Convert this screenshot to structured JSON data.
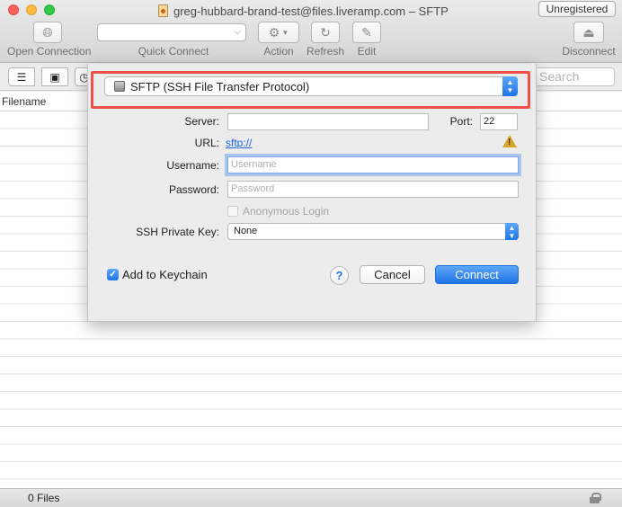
{
  "window": {
    "title": "greg-hubbard-brand-test@files.liveramp.com – SFTP",
    "badge": "Unregistered"
  },
  "toolbar": {
    "open_connection": "Open Connection",
    "quick_connect": "Quick Connect",
    "quick_connect_value": "",
    "action": "Action",
    "refresh": "Refresh",
    "edit": "Edit",
    "disconnect": "Disconnect"
  },
  "browser": {
    "search_placeholder": "Search",
    "column_filename": "Filename",
    "status": "0 Files"
  },
  "dialog": {
    "protocol": "SFTP (SSH File Transfer Protocol)",
    "server_label": "Server:",
    "server_value": "",
    "port_label": "Port:",
    "port_value": "22",
    "url_label": "URL:",
    "url_value": "sftp://",
    "username_label": "Username:",
    "username_placeholder": "Username",
    "password_label": "Password:",
    "password_placeholder": "Password",
    "anonymous_login": "Anonymous Login",
    "ssh_key_label": "SSH Private Key:",
    "ssh_key_value": "None",
    "add_to_keychain": "Add to Keychain",
    "add_to_keychain_checked": true,
    "help": "?",
    "cancel": "Cancel",
    "connect": "Connect"
  },
  "colors": {
    "accent": "#1f74e6",
    "highlight": "#f0504a",
    "warning": "#d8a42a"
  }
}
